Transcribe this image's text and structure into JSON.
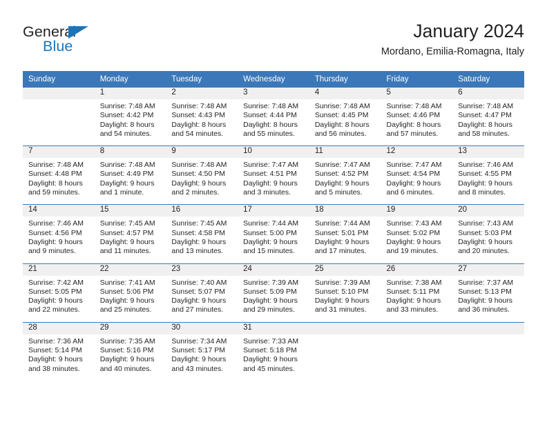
{
  "brand": {
    "name_part1": "General",
    "name_part2": "Blue",
    "accent_color": "#1b75bb"
  },
  "header": {
    "title": "January 2024",
    "subtitle": "Mordano, Emilia-Romagna, Italy"
  },
  "calendar": {
    "header_bg": "#3a78ba",
    "daynum_bg": "#f0f0f0",
    "weekday_headers": [
      "Sunday",
      "Monday",
      "Tuesday",
      "Wednesday",
      "Thursday",
      "Friday",
      "Saturday"
    ],
    "weeks": [
      [
        {
          "day": "",
          "sunrise": "",
          "sunset": "",
          "daylight": ""
        },
        {
          "day": "1",
          "sunrise": "Sunrise: 7:48 AM",
          "sunset": "Sunset: 4:42 PM",
          "daylight": "Daylight: 8 hours and 54 minutes."
        },
        {
          "day": "2",
          "sunrise": "Sunrise: 7:48 AM",
          "sunset": "Sunset: 4:43 PM",
          "daylight": "Daylight: 8 hours and 54 minutes."
        },
        {
          "day": "3",
          "sunrise": "Sunrise: 7:48 AM",
          "sunset": "Sunset: 4:44 PM",
          "daylight": "Daylight: 8 hours and 55 minutes."
        },
        {
          "day": "4",
          "sunrise": "Sunrise: 7:48 AM",
          "sunset": "Sunset: 4:45 PM",
          "daylight": "Daylight: 8 hours and 56 minutes."
        },
        {
          "day": "5",
          "sunrise": "Sunrise: 7:48 AM",
          "sunset": "Sunset: 4:46 PM",
          "daylight": "Daylight: 8 hours and 57 minutes."
        },
        {
          "day": "6",
          "sunrise": "Sunrise: 7:48 AM",
          "sunset": "Sunset: 4:47 PM",
          "daylight": "Daylight: 8 hours and 58 minutes."
        }
      ],
      [
        {
          "day": "7",
          "sunrise": "Sunrise: 7:48 AM",
          "sunset": "Sunset: 4:48 PM",
          "daylight": "Daylight: 8 hours and 59 minutes."
        },
        {
          "day": "8",
          "sunrise": "Sunrise: 7:48 AM",
          "sunset": "Sunset: 4:49 PM",
          "daylight": "Daylight: 9 hours and 1 minute."
        },
        {
          "day": "9",
          "sunrise": "Sunrise: 7:48 AM",
          "sunset": "Sunset: 4:50 PM",
          "daylight": "Daylight: 9 hours and 2 minutes."
        },
        {
          "day": "10",
          "sunrise": "Sunrise: 7:47 AM",
          "sunset": "Sunset: 4:51 PM",
          "daylight": "Daylight: 9 hours and 3 minutes."
        },
        {
          "day": "11",
          "sunrise": "Sunrise: 7:47 AM",
          "sunset": "Sunset: 4:52 PM",
          "daylight": "Daylight: 9 hours and 5 minutes."
        },
        {
          "day": "12",
          "sunrise": "Sunrise: 7:47 AM",
          "sunset": "Sunset: 4:54 PM",
          "daylight": "Daylight: 9 hours and 6 minutes."
        },
        {
          "day": "13",
          "sunrise": "Sunrise: 7:46 AM",
          "sunset": "Sunset: 4:55 PM",
          "daylight": "Daylight: 9 hours and 8 minutes."
        }
      ],
      [
        {
          "day": "14",
          "sunrise": "Sunrise: 7:46 AM",
          "sunset": "Sunset: 4:56 PM",
          "daylight": "Daylight: 9 hours and 9 minutes."
        },
        {
          "day": "15",
          "sunrise": "Sunrise: 7:45 AM",
          "sunset": "Sunset: 4:57 PM",
          "daylight": "Daylight: 9 hours and 11 minutes."
        },
        {
          "day": "16",
          "sunrise": "Sunrise: 7:45 AM",
          "sunset": "Sunset: 4:58 PM",
          "daylight": "Daylight: 9 hours and 13 minutes."
        },
        {
          "day": "17",
          "sunrise": "Sunrise: 7:44 AM",
          "sunset": "Sunset: 5:00 PM",
          "daylight": "Daylight: 9 hours and 15 minutes."
        },
        {
          "day": "18",
          "sunrise": "Sunrise: 7:44 AM",
          "sunset": "Sunset: 5:01 PM",
          "daylight": "Daylight: 9 hours and 17 minutes."
        },
        {
          "day": "19",
          "sunrise": "Sunrise: 7:43 AM",
          "sunset": "Sunset: 5:02 PM",
          "daylight": "Daylight: 9 hours and 19 minutes."
        },
        {
          "day": "20",
          "sunrise": "Sunrise: 7:43 AM",
          "sunset": "Sunset: 5:03 PM",
          "daylight": "Daylight: 9 hours and 20 minutes."
        }
      ],
      [
        {
          "day": "21",
          "sunrise": "Sunrise: 7:42 AM",
          "sunset": "Sunset: 5:05 PM",
          "daylight": "Daylight: 9 hours and 22 minutes."
        },
        {
          "day": "22",
          "sunrise": "Sunrise: 7:41 AM",
          "sunset": "Sunset: 5:06 PM",
          "daylight": "Daylight: 9 hours and 25 minutes."
        },
        {
          "day": "23",
          "sunrise": "Sunrise: 7:40 AM",
          "sunset": "Sunset: 5:07 PM",
          "daylight": "Daylight: 9 hours and 27 minutes."
        },
        {
          "day": "24",
          "sunrise": "Sunrise: 7:39 AM",
          "sunset": "Sunset: 5:09 PM",
          "daylight": "Daylight: 9 hours and 29 minutes."
        },
        {
          "day": "25",
          "sunrise": "Sunrise: 7:39 AM",
          "sunset": "Sunset: 5:10 PM",
          "daylight": "Daylight: 9 hours and 31 minutes."
        },
        {
          "day": "26",
          "sunrise": "Sunrise: 7:38 AM",
          "sunset": "Sunset: 5:11 PM",
          "daylight": "Daylight: 9 hours and 33 minutes."
        },
        {
          "day": "27",
          "sunrise": "Sunrise: 7:37 AM",
          "sunset": "Sunset: 5:13 PM",
          "daylight": "Daylight: 9 hours and 36 minutes."
        }
      ],
      [
        {
          "day": "28",
          "sunrise": "Sunrise: 7:36 AM",
          "sunset": "Sunset: 5:14 PM",
          "daylight": "Daylight: 9 hours and 38 minutes."
        },
        {
          "day": "29",
          "sunrise": "Sunrise: 7:35 AM",
          "sunset": "Sunset: 5:16 PM",
          "daylight": "Daylight: 9 hours and 40 minutes."
        },
        {
          "day": "30",
          "sunrise": "Sunrise: 7:34 AM",
          "sunset": "Sunset: 5:17 PM",
          "daylight": "Daylight: 9 hours and 43 minutes."
        },
        {
          "day": "31",
          "sunrise": "Sunrise: 7:33 AM",
          "sunset": "Sunset: 5:18 PM",
          "daylight": "Daylight: 9 hours and 45 minutes."
        },
        {
          "day": "",
          "sunrise": "",
          "sunset": "",
          "daylight": ""
        },
        {
          "day": "",
          "sunrise": "",
          "sunset": "",
          "daylight": ""
        },
        {
          "day": "",
          "sunrise": "",
          "sunset": "",
          "daylight": ""
        }
      ]
    ]
  }
}
